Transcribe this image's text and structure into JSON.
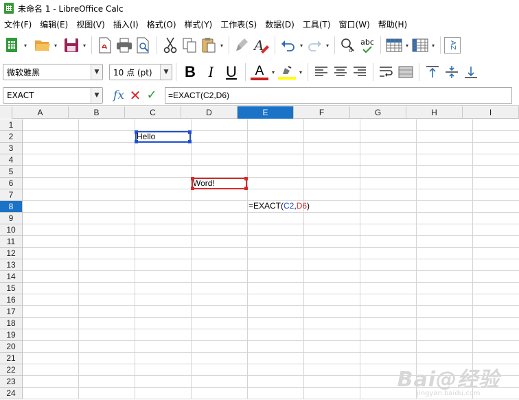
{
  "window": {
    "title": "未命名 1 - LibreOffice Calc"
  },
  "menu": [
    {
      "label": "文件(F)"
    },
    {
      "label": "编辑(E)"
    },
    {
      "label": "视图(V)"
    },
    {
      "label": "插入(I)"
    },
    {
      "label": "格式(O)"
    },
    {
      "label": "样式(Y)"
    },
    {
      "label": "工作表(S)"
    },
    {
      "label": "数据(D)"
    },
    {
      "label": "工具(T)"
    },
    {
      "label": "窗口(W)"
    },
    {
      "label": "帮助(H)"
    }
  ],
  "toolbar": {
    "spellcheck_label": "abc",
    "sort_label": "AZ"
  },
  "formatting": {
    "font_name": "微软雅黑",
    "font_size": "10 点 (pt)",
    "bold": "B",
    "italic": "I",
    "underline": "U",
    "font_color_glyph": "A",
    "font_color": "#c9211e",
    "highlight_color": "#ffff00"
  },
  "formula_bar": {
    "name_box": "EXACT",
    "fx": "fx",
    "formula": "=EXACT(C2,D6)"
  },
  "sheet": {
    "columns": [
      "A",
      "B",
      "C",
      "D",
      "E",
      "F",
      "G",
      "H",
      "I"
    ],
    "rows": [
      "1",
      "2",
      "3",
      "4",
      "5",
      "6",
      "7",
      "8",
      "9",
      "10",
      "11",
      "12",
      "13",
      "14",
      "15",
      "16",
      "17",
      "18",
      "19",
      "20",
      "21",
      "22",
      "23",
      "24"
    ],
    "active_column": "E",
    "active_row": "8",
    "cells": {
      "C2": "Hello",
      "D6": "Word!"
    },
    "editing": {
      "prefix": "=EXACT(",
      "ref1": "C2",
      "comma": ",",
      "ref2": "D6",
      "suffix": ")"
    }
  },
  "watermark": {
    "main": "Bai@经验",
    "sub": "jingyan.baidu.com"
  },
  "colors": {
    "accent": "#1a73c7",
    "ref_blue": "#1f4fd0",
    "ref_red": "#d92c2c"
  }
}
